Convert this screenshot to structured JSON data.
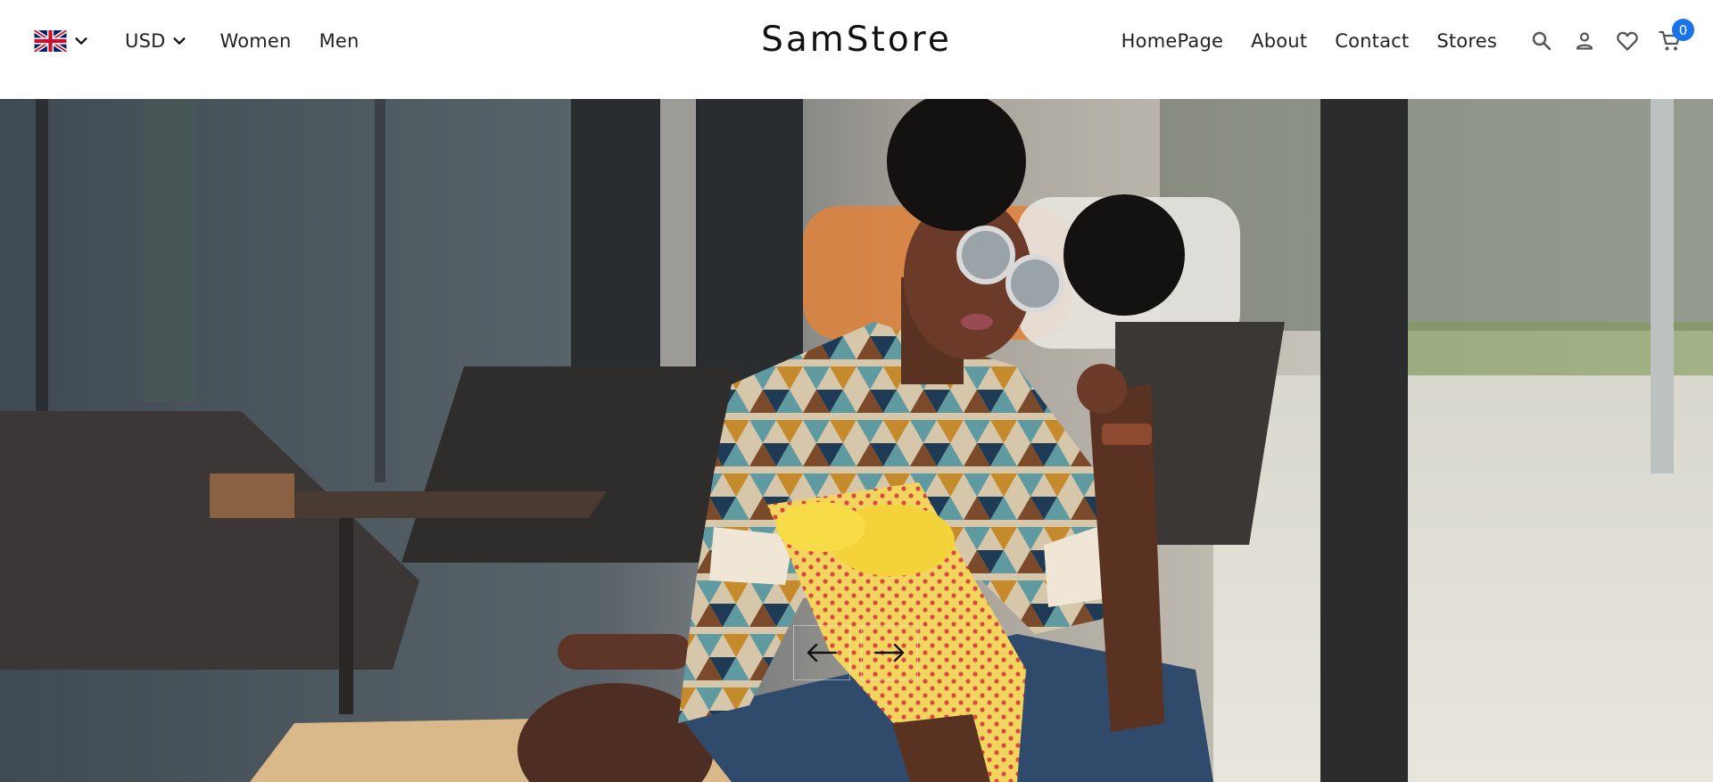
{
  "header": {
    "language": {
      "flag_icon": "uk-flag-icon",
      "dropdown_icon": "chevron-down-icon"
    },
    "currency": {
      "value": "USD",
      "dropdown_icon": "chevron-down-icon"
    },
    "left_links": [
      "Women",
      "Men"
    ],
    "brand": "SamStore",
    "right_links": [
      "HomePage",
      "About",
      "Contact",
      "Stores"
    ],
    "icons": [
      "search-icon",
      "user-icon",
      "heart-icon",
      "cart-icon"
    ],
    "cart_count": "0"
  },
  "hero": {
    "image": "woman-with-sunglasses-holding-yellow-tulips",
    "prev_icon": "arrow-left-icon",
    "next_icon": "arrow-right-icon"
  },
  "colors": {
    "badge": "#1a73e8",
    "text": "#222222",
    "background": "#ffffff"
  }
}
